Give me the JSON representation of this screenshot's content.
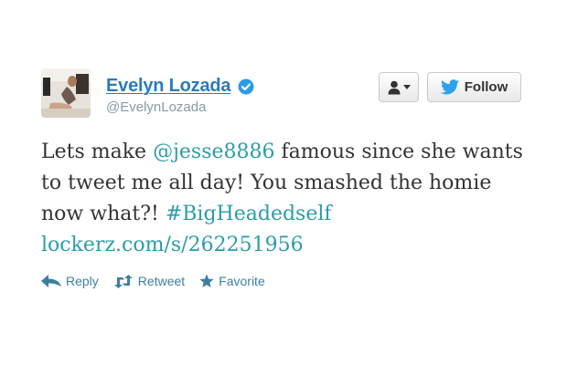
{
  "user": {
    "display_name": "Evelyn Lozada",
    "handle": "@EvelynLozada",
    "verified_icon": "verified-badge-icon"
  },
  "buttons": {
    "follow_label": "Follow",
    "user_menu_icon": "person-dropdown-icon"
  },
  "tweet": {
    "t1": "Lets make ",
    "mention": "@jesse8886",
    "t2": " famous since she wants to tweet me all day! You smashed the homie now what?! ",
    "hashtag": "#BigHeadedself",
    "url": "lockerz.com/s/262251956"
  },
  "actions": {
    "reply": "Reply",
    "retweet": "Retweet",
    "favorite": "Favorite"
  },
  "colors": {
    "link": "#2b9da8",
    "name": "#2b7bb9",
    "action": "#3e7fa0"
  }
}
